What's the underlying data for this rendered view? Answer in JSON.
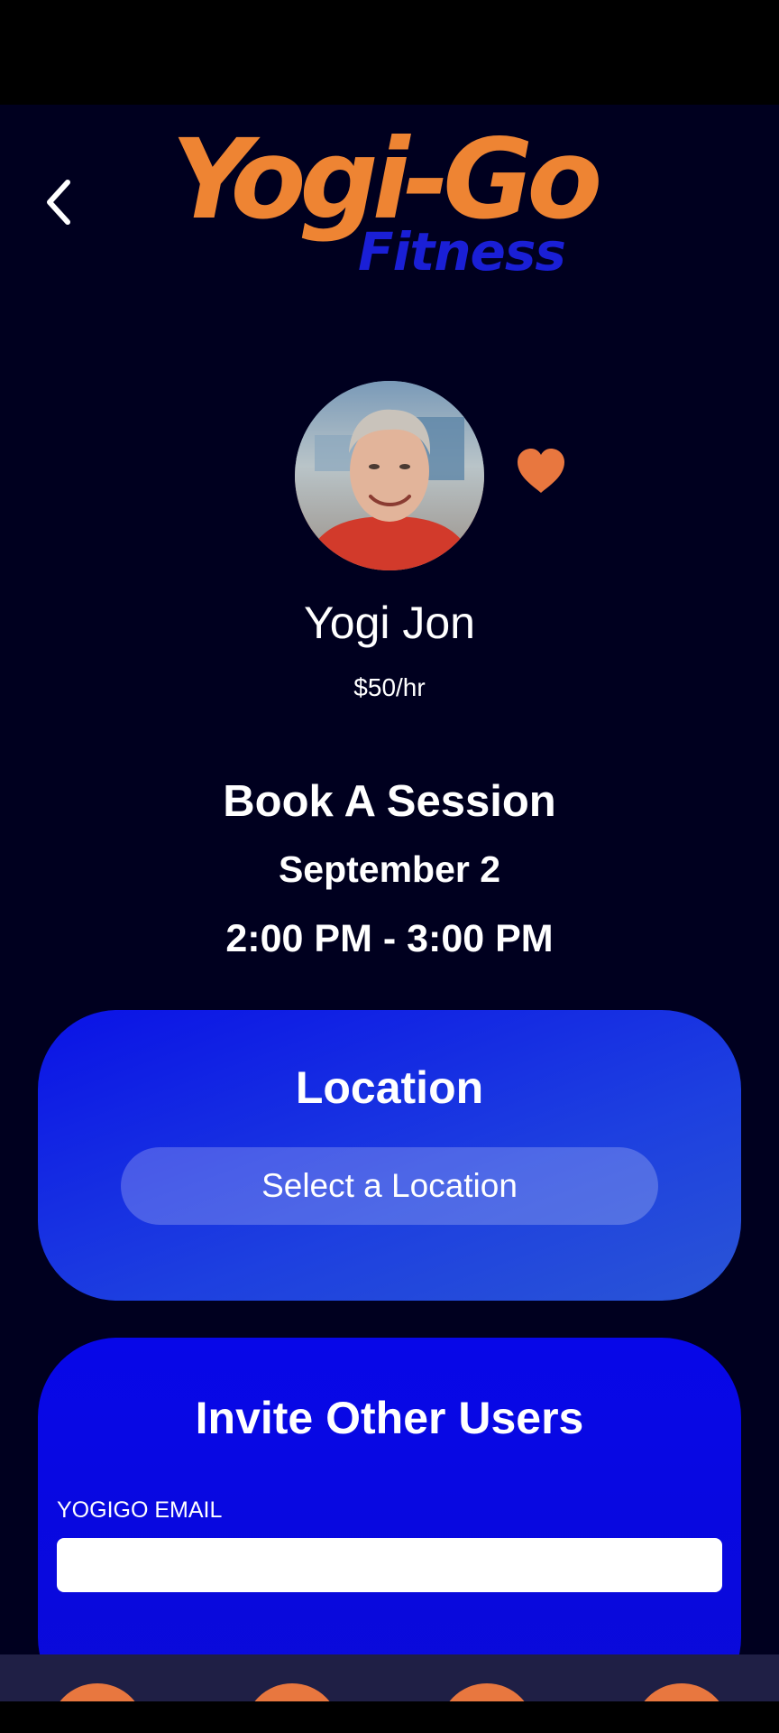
{
  "header": {
    "logo_main": "Yogi-Go",
    "logo_sub": "Fitness"
  },
  "trainer": {
    "name": "Yogi Jon",
    "rate": "$50/hr"
  },
  "booking": {
    "title": "Book A Session",
    "date": "September 2",
    "time": "2:00 PM - 3:00 PM"
  },
  "location": {
    "title": "Location",
    "select_label": "Select a Location"
  },
  "invite": {
    "title": "Invite Other Users",
    "email_label": "YOGIGO EMAIL",
    "email_value": ""
  },
  "icons": {
    "back": "chevron-left-icon",
    "favorite": "heart-icon",
    "tabs": [
      "home-icon",
      "profile-icon",
      "favorites-icon",
      "calendar-icon"
    ]
  },
  "colors": {
    "background": "#00001f",
    "accent_orange": "#e8773f",
    "logo_orange": "#ee8433",
    "logo_blue": "#1a1fd6",
    "card_blue": "#0707e8",
    "tabbar": "#1f1f45"
  }
}
